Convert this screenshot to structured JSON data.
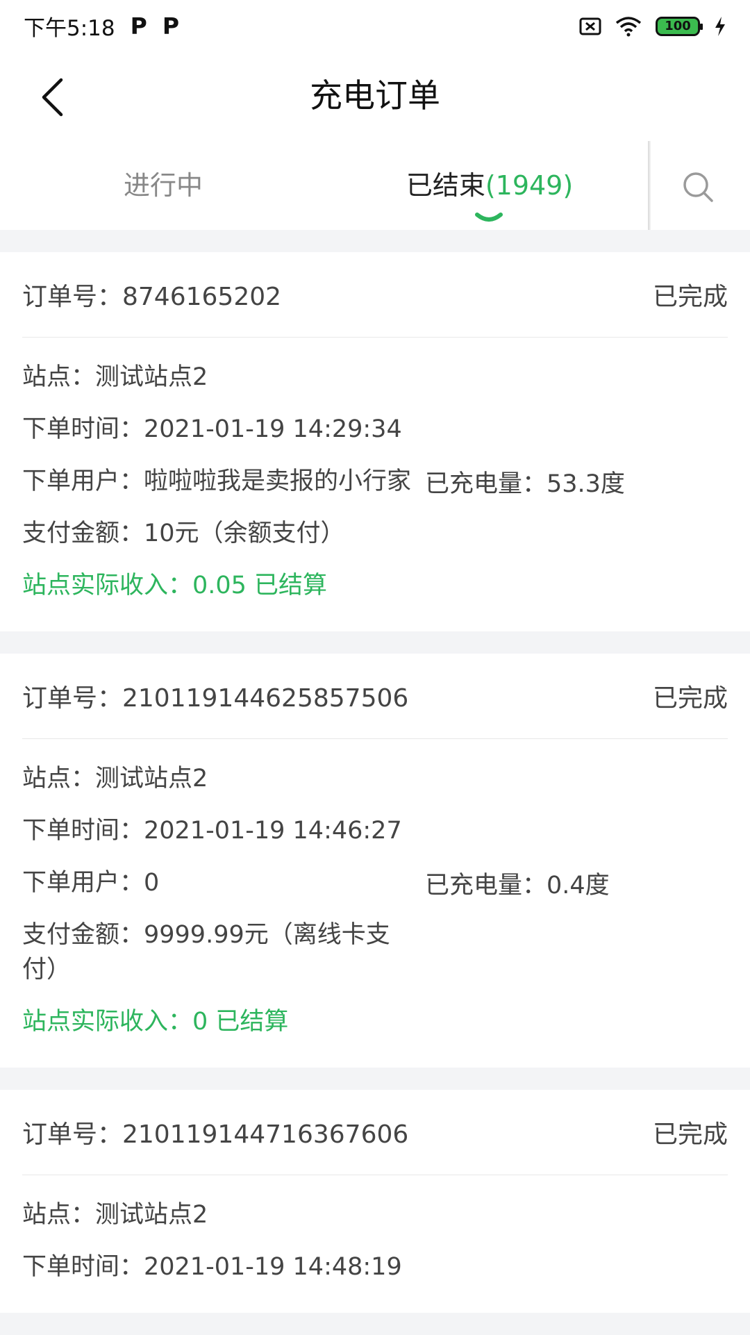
{
  "status_bar": {
    "time": "下午5:18",
    "icons": [
      "parking-icon",
      "parking-icon"
    ],
    "battery": "100"
  },
  "nav": {
    "title": "充电订单"
  },
  "tabs": {
    "ongoing": "进行中",
    "ended_label": "已结束",
    "ended_count": "(1949)"
  },
  "colors": {
    "accent": "#2db55d",
    "background": "#f3f4f6"
  },
  "orders": [
    {
      "order_no": "订单号：8746165202",
      "status": "已完成",
      "station": "站点：测试站点2",
      "order_time": "下单时间：2021-01-19 14:29:34",
      "user": "下单用户：啦啦啦我是卖报的小行家",
      "charged": "已充电量：53.3度",
      "payment": "支付金额：10元（余额支付）",
      "income": "站点实际收入：0.05 已结算"
    },
    {
      "order_no": "订单号：210119144625857506",
      "status": "已完成",
      "station": "站点：测试站点2",
      "order_time": "下单时间：2021-01-19 14:46:27",
      "user": "下单用户：0",
      "charged": "已充电量：0.4度",
      "payment": "支付金额：9999.99元（离线卡支付）",
      "income": "站点实际收入：0 已结算"
    },
    {
      "order_no": "订单号：210119144716367606",
      "status": "已完成",
      "station": "站点：测试站点2",
      "order_time": "下单时间：2021-01-19 14:48:19"
    }
  ]
}
